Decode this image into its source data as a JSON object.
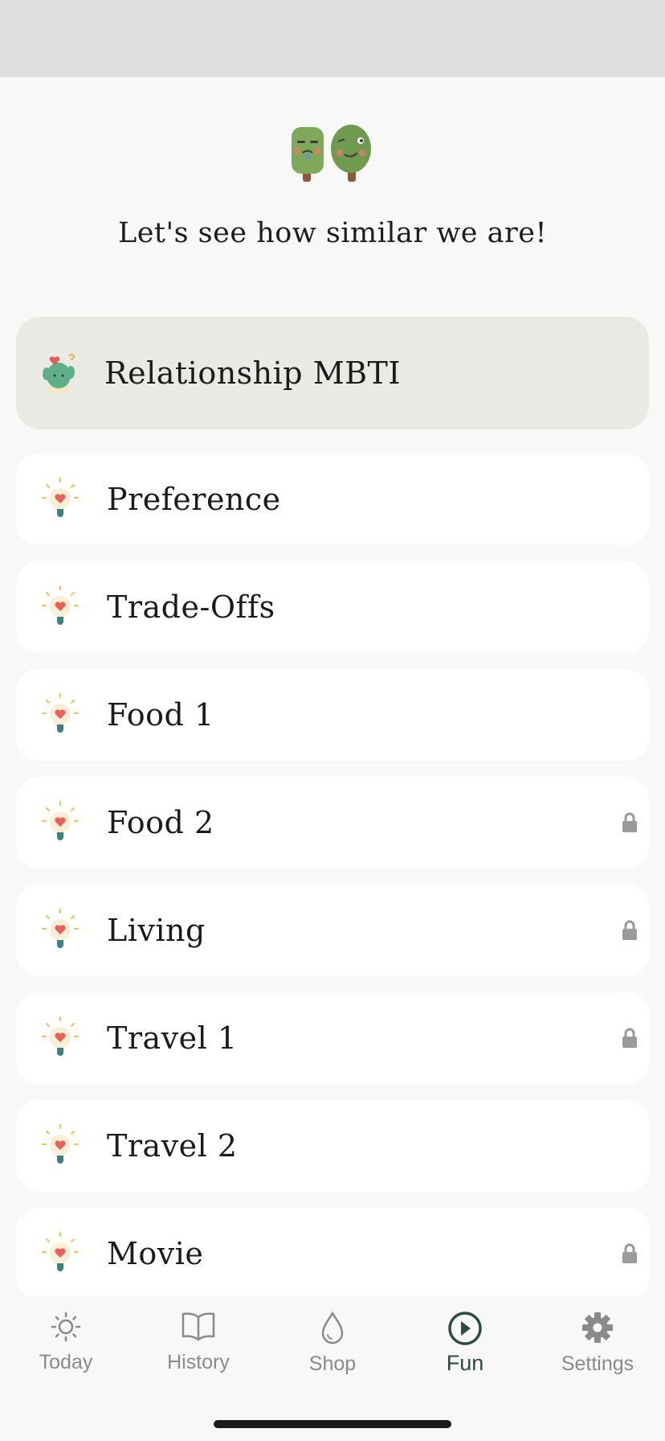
{
  "hero": {
    "title": "Let's see how similar we are!"
  },
  "featured": {
    "label": "Relationship MBTI",
    "icon": "cactus-icon"
  },
  "items": [
    {
      "label": "Preference",
      "locked": false
    },
    {
      "label": "Trade-Offs",
      "locked": false
    },
    {
      "label": "Food 1",
      "locked": false
    },
    {
      "label": "Food 2",
      "locked": true
    },
    {
      "label": "Living",
      "locked": true
    },
    {
      "label": "Travel 1",
      "locked": true
    },
    {
      "label": "Travel 2",
      "locked": false
    },
    {
      "label": "Movie",
      "locked": true
    }
  ],
  "tabs": [
    {
      "label": "Today",
      "icon": "sun-icon",
      "active": false
    },
    {
      "label": "History",
      "icon": "book-icon",
      "active": false
    },
    {
      "label": "Shop",
      "icon": "drop-icon",
      "active": false
    },
    {
      "label": "Fun",
      "icon": "play-circle-icon",
      "active": true
    },
    {
      "label": "Settings",
      "icon": "gear-icon",
      "active": false
    }
  ],
  "colors": {
    "background": "#f8f8f8",
    "card": "#ffffff",
    "featured_card": "#e8eae3",
    "active_tab": "#2c4a46",
    "inactive_tab": "#8a8a8a",
    "lock": "#9a9a9a"
  }
}
